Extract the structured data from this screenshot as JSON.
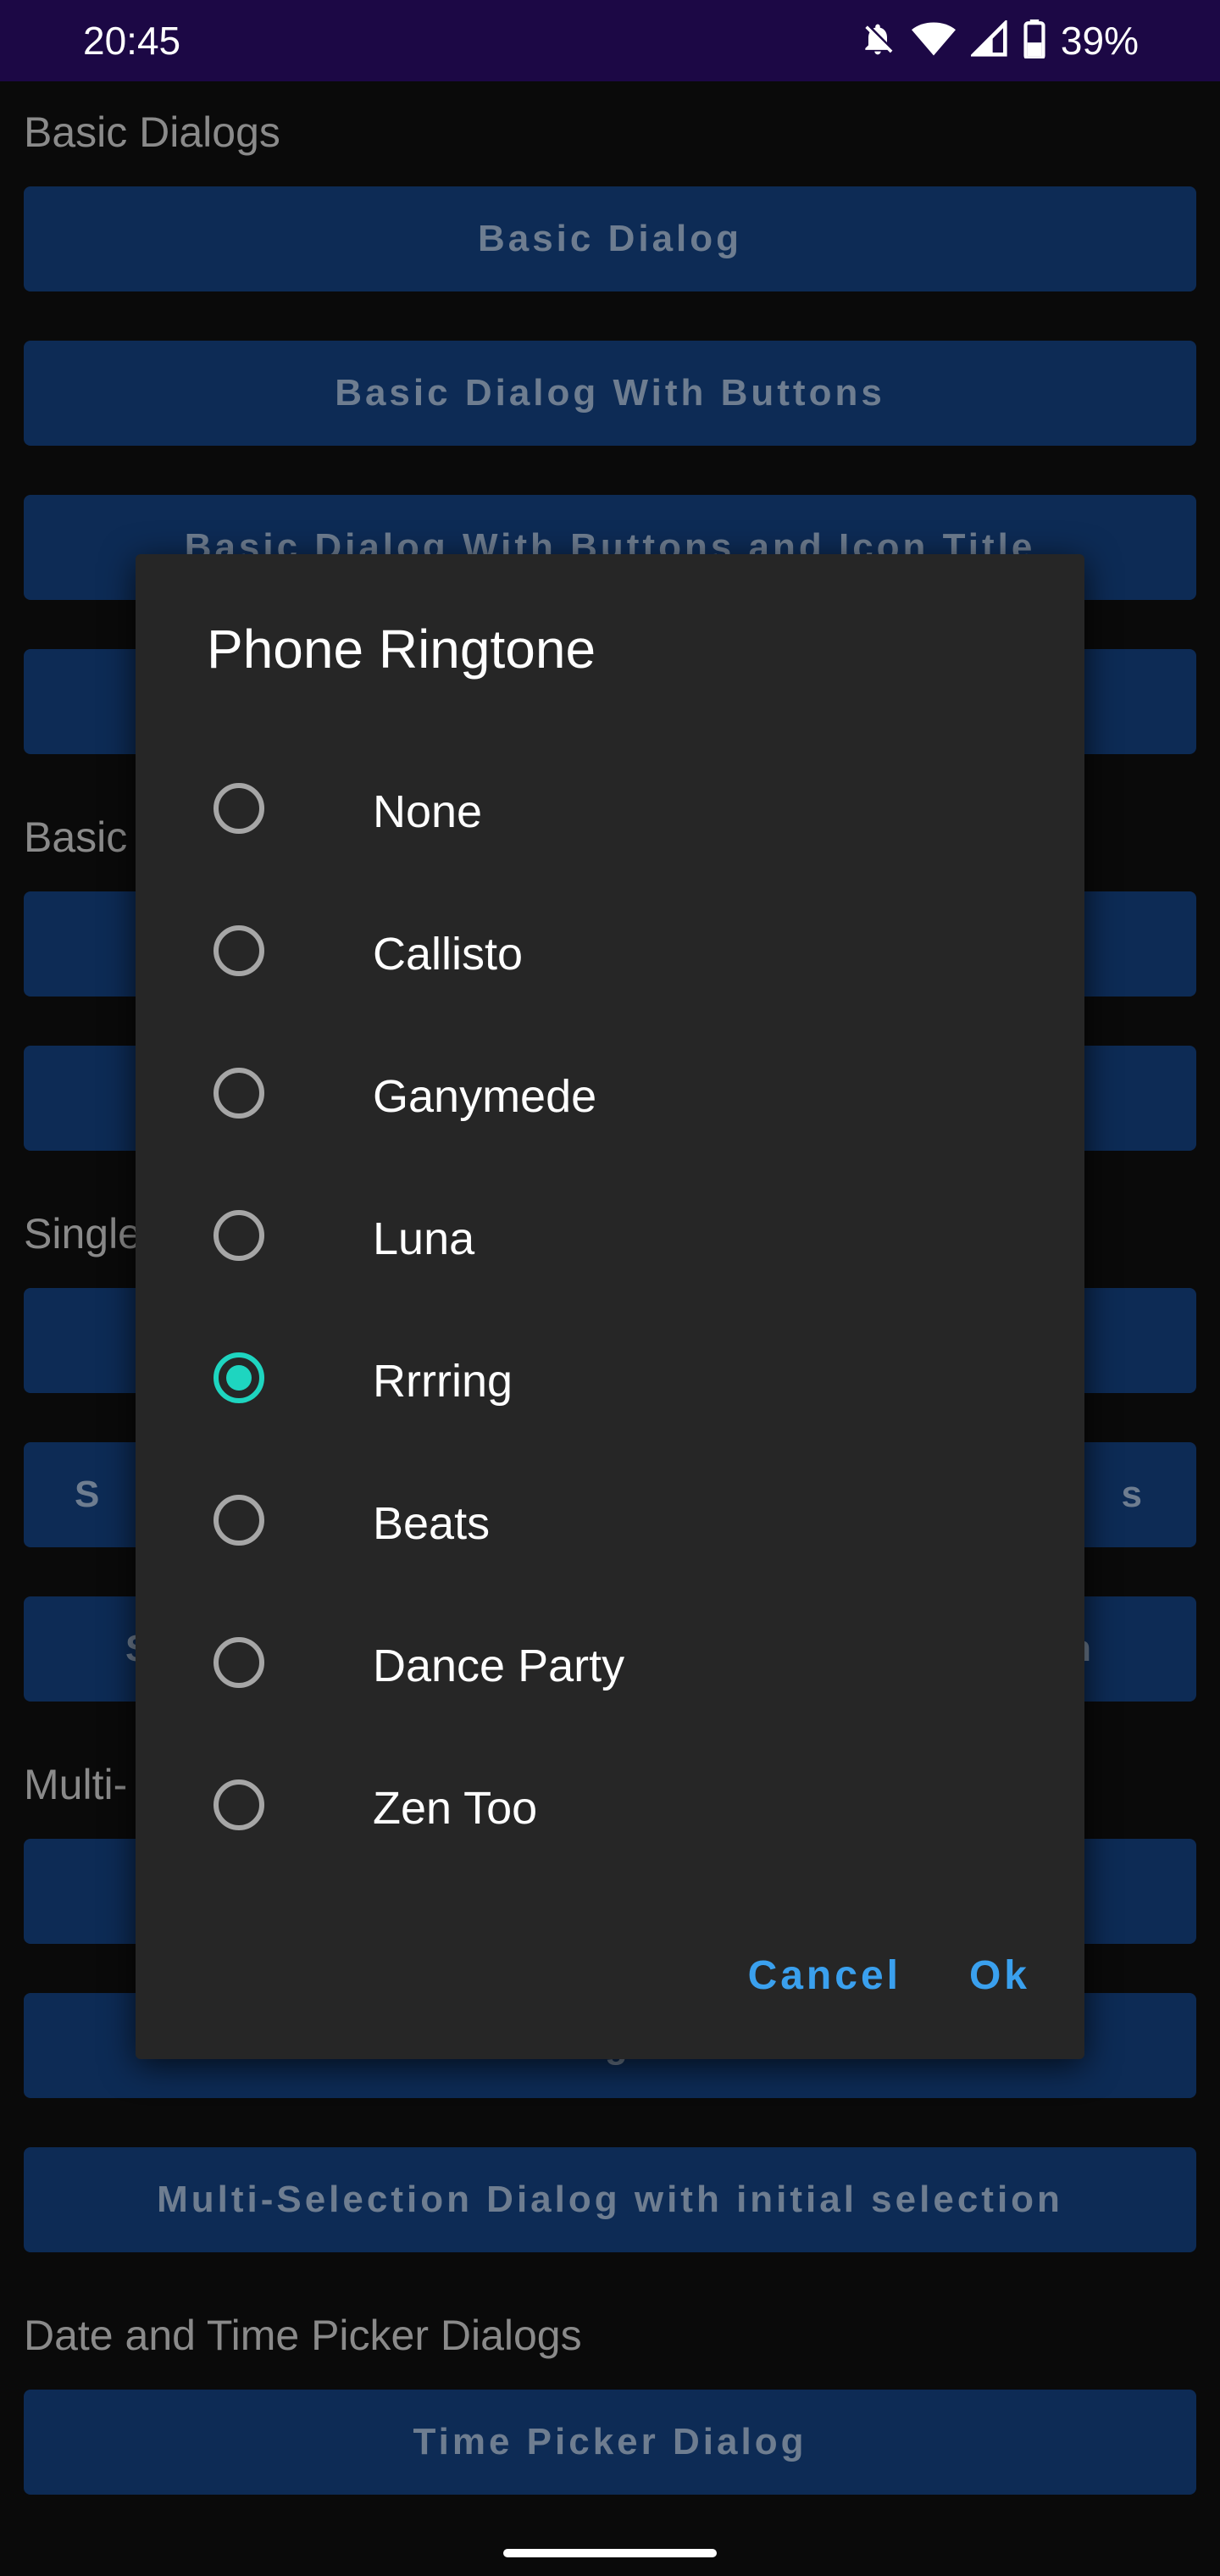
{
  "status_bar": {
    "time": "20:45",
    "battery": "39%",
    "icons": [
      "bell-off-icon",
      "wifi-icon",
      "signal-icon",
      "battery-icon"
    ]
  },
  "background": {
    "sections": {
      "basic": "Basic Dialogs",
      "basic_cut": "Basic",
      "single_cut": "Single",
      "multi_cut": "Multi-",
      "datetime": "Date and Time Picker Dialogs"
    },
    "buttons": {
      "basic_dialog": "Basic Dialog",
      "basic_with_buttons": "Basic Dialog With Buttons",
      "basic_with_icon": "Basic Dialog With Buttons and Icon Title",
      "multi_disabled": "Multi-Selection Dialog with disabled Items",
      "multi_initial": "Multi-Selection Dialog with initial selection",
      "time_picker": "Time Picker Dialog",
      "single_2_left": "S",
      "single_2_right": "s",
      "single_3_left": "S",
      "single_3_right": "n"
    }
  },
  "dialog": {
    "title": "Phone Ringtone",
    "options": [
      {
        "label": "None",
        "selected": false
      },
      {
        "label": "Callisto",
        "selected": false
      },
      {
        "label": "Ganymede",
        "selected": false
      },
      {
        "label": "Luna",
        "selected": false
      },
      {
        "label": "Rrrring",
        "selected": true
      },
      {
        "label": "Beats",
        "selected": false
      },
      {
        "label": "Dance Party",
        "selected": false
      },
      {
        "label": "Zen Too",
        "selected": false
      }
    ],
    "cancel_label": "Cancel",
    "ok_label": "Ok",
    "accent_color": "#1ed5c0",
    "action_color": "#3aa0ee"
  }
}
